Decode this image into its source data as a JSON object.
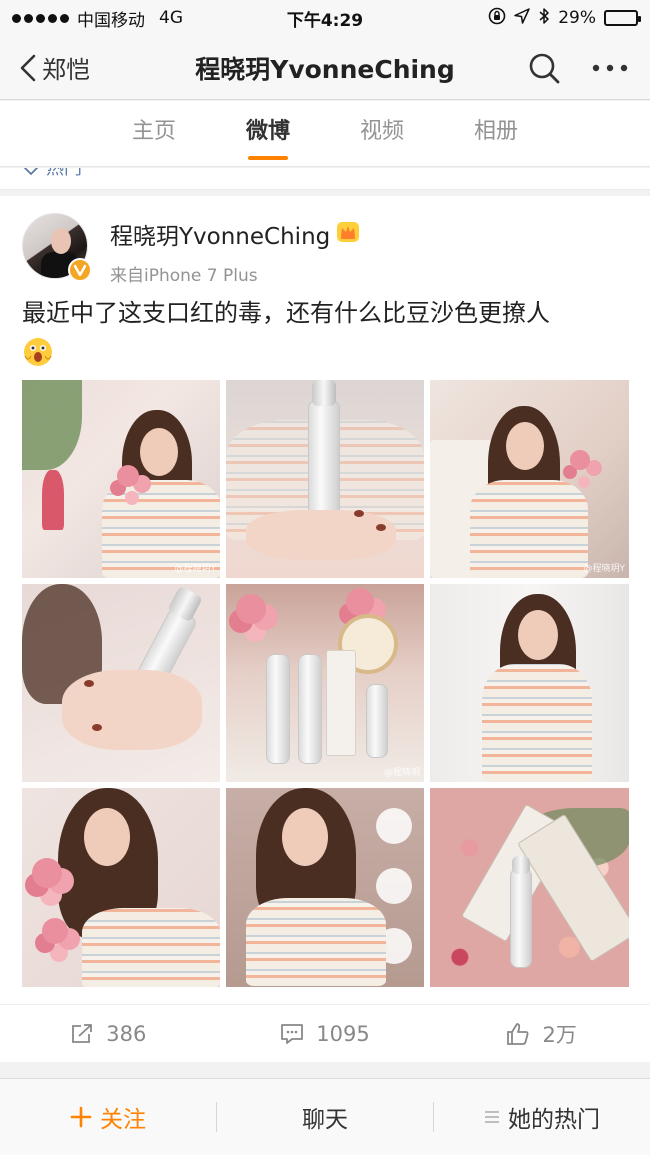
{
  "status_bar": {
    "carrier": "中国移动",
    "network": "4G",
    "time": "下午4:29",
    "battery_text": "29%",
    "battery_level": 0.29,
    "icons": [
      "signal-dots-icon",
      "orientation-lock-icon",
      "location-icon",
      "bluetooth-icon",
      "battery-icon"
    ]
  },
  "nav": {
    "back_label": "郑恺",
    "title": "程晓玥YvonneChing",
    "icons": [
      "chevron-left-icon",
      "search-icon",
      "more-icon"
    ]
  },
  "tabs": [
    {
      "label": "主页",
      "active": false
    },
    {
      "label": "微博",
      "active": true
    },
    {
      "label": "视频",
      "active": false
    },
    {
      "label": "相册",
      "active": false
    }
  ],
  "hot_strip": {
    "label": "热门",
    "icon": "thumb-icon"
  },
  "post": {
    "author": "程晓玥YvonneChing",
    "source": "来自iPhone 7 Plus",
    "text": "最近中了这支口红的毒，还有什么比豆沙色更撩人",
    "emoji": "surprised-face-emoji",
    "member_badge": "crown-member-icon",
    "verified_badge": "v-verified-icon",
    "photos": [
      {
        "watermark": "@程晓玥Y"
      },
      {
        "watermark": ""
      },
      {
        "watermark": "@程晓玥Y"
      },
      {
        "watermark": ""
      },
      {
        "watermark": "@程晓玥"
      },
      {
        "watermark": ""
      },
      {
        "watermark": ""
      },
      {
        "watermark": ""
      },
      {
        "watermark": ""
      }
    ]
  },
  "actions": {
    "repost": {
      "count": "386",
      "icon": "repost-icon"
    },
    "comment": {
      "count": "1095",
      "icon": "comment-icon"
    },
    "like": {
      "count": "2万",
      "icon": "like-icon"
    }
  },
  "toolbar": {
    "follow_label": "关注",
    "chat_label": "聊天",
    "hot_label": "她的热门",
    "icons": [
      "plus-icon",
      "list-icon"
    ]
  },
  "colors": {
    "accent": "#ff8200",
    "text": "#333333",
    "muted": "#939393",
    "background": "#f2f2f2"
  }
}
